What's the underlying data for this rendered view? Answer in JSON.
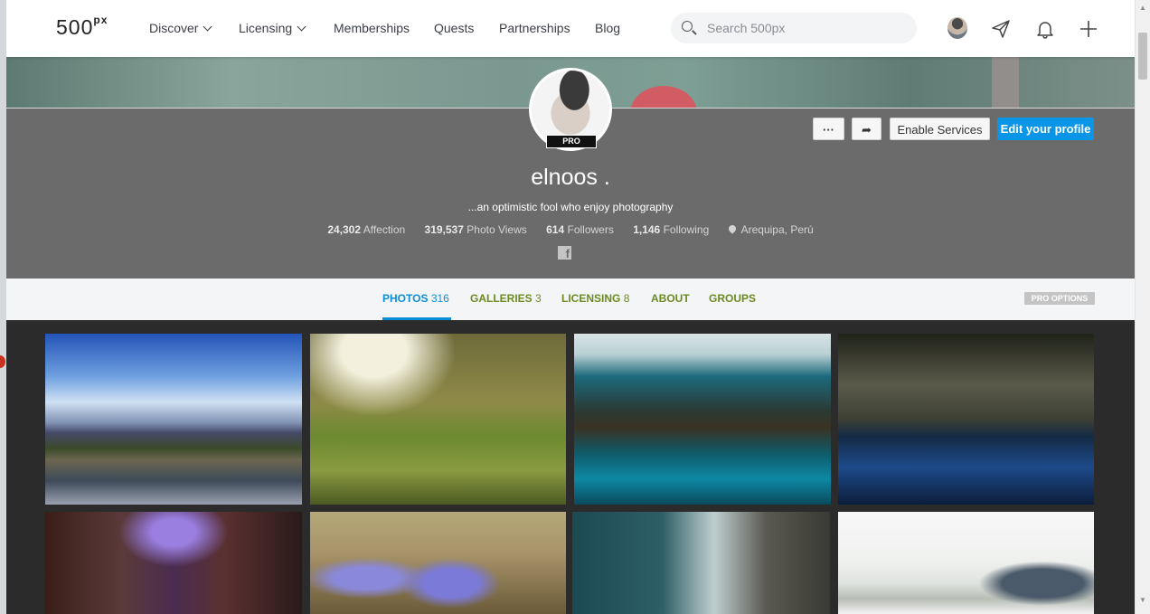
{
  "nav": {
    "logo": "500",
    "logo_suffix": "px",
    "items": [
      {
        "label": "Discover",
        "dropdown": true
      },
      {
        "label": "Licensing",
        "dropdown": true
      },
      {
        "label": "Memberships"
      },
      {
        "label": "Quests"
      },
      {
        "label": "Partnerships"
      },
      {
        "label": "Blog"
      }
    ],
    "search": {
      "placeholder": "Search 500px"
    },
    "icons": [
      "avatar",
      "paper-plane-icon",
      "bell-icon",
      "plus-icon"
    ]
  },
  "profile": {
    "pro_badge": "PRO",
    "name": "elnoos .",
    "bio": "...an optimistic fool who enjoy photography",
    "stats": [
      {
        "value": "24,302",
        "label": "Affection"
      },
      {
        "value": "319,537",
        "label": "Photo Views"
      },
      {
        "value": "614",
        "label": "Followers"
      },
      {
        "value": "1,146",
        "label": "Following"
      }
    ],
    "location": "Arequipa, Perú",
    "buttons": {
      "more": "···",
      "share": "➦",
      "enable_services": "Enable Services",
      "edit_profile": "Edit your profile"
    },
    "social": {
      "facebook": "f"
    }
  },
  "tabs": [
    {
      "label": "PHOTOS",
      "count": "316",
      "active": true
    },
    {
      "label": "GALLERIES",
      "count": "3"
    },
    {
      "label": "LICENSING",
      "count": "8"
    },
    {
      "label": "ABOUT",
      "count": ""
    },
    {
      "label": "GROUPS",
      "count": ""
    }
  ],
  "pro_options": "PRO OPTIONS",
  "colors": {
    "accent_blue": "#0b8fd8",
    "tab_green": "#6d8a21",
    "profile_bg": "#6b6b6b"
  }
}
